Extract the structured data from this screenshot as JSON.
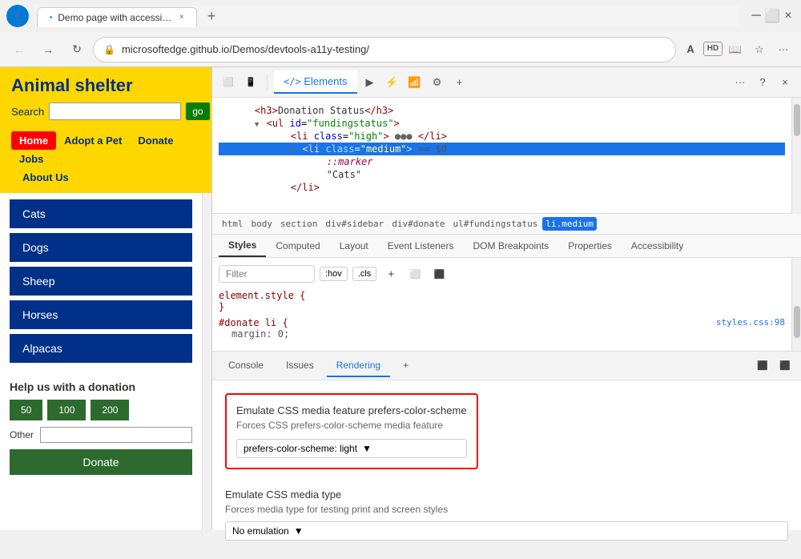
{
  "browser": {
    "title": "Demo page with accessibility iss…",
    "url": "microsoftedge.github.io/Demos/devtools-a11y-testing/",
    "tab_close": "×",
    "new_tab": "+"
  },
  "nav": {
    "back": "←",
    "forward": "→",
    "refresh": "↻",
    "search": "🔍"
  },
  "website": {
    "title": "Animal shelter",
    "search_label": "Search",
    "search_placeholder": "",
    "go_btn": "go",
    "menu": {
      "home": "Home",
      "adopt": "Adopt a Pet",
      "donate": "Donate",
      "jobs": "Jobs",
      "about": "About Us"
    },
    "animals": [
      "Cats",
      "Dogs",
      "Sheep",
      "Horses",
      "Alpacas"
    ],
    "donation_title": "Help us with a donation",
    "amounts": [
      "50",
      "100",
      "200"
    ],
    "other_label": "Other",
    "donate_btn": "Donate"
  },
  "devtools": {
    "tabs": [
      "←/>",
      "Elements",
      "⬜",
      "⚡",
      "📶",
      "⚙",
      "+"
    ],
    "elements_tab": "Elements",
    "more": "···",
    "question": "?",
    "close": "×",
    "dom": {
      "lines": [
        {
          "indent": 2,
          "content": "<h3>Donation Status</h3>"
        },
        {
          "indent": 2,
          "content": "▼ <ul id=\"fundingstatus\">"
        },
        {
          "indent": 3,
          "content": "<li class=\"high\"> ●●● </li>"
        },
        {
          "indent": 3,
          "content": "▼ <li class=\"medium\"> == $0"
        },
        {
          "indent": 4,
          "content": "::marker"
        },
        {
          "indent": 4,
          "content": "\"Cats\""
        },
        {
          "indent": 3,
          "content": "</li>"
        }
      ]
    },
    "breadcrumbs": [
      "html",
      "body",
      "section",
      "div#sidebar",
      "div#donate",
      "ul#fundingstatus",
      "li.medium"
    ],
    "styles_tabs": [
      "Styles",
      "Computed",
      "Layout",
      "Event Listeners",
      "DOM Breakpoints",
      "Properties",
      "Accessibility"
    ],
    "filter_placeholder": "Filter",
    "filter_toggle1": ":hov",
    "filter_toggle2": ".cls",
    "filter_icon1": "+",
    "filter_icon2": "⬜",
    "filter_icon3": "⬛",
    "style_rules": [
      {
        "selector": "element.style {",
        "close": "}",
        "properties": []
      },
      {
        "selector": "#donate li {",
        "close": "",
        "link": "styles.css:98",
        "properties": [
          "margin: 0;"
        ]
      }
    ],
    "bottom_tabs": [
      "Console",
      "Issues",
      "Rendering",
      "+"
    ],
    "rendering_active": true,
    "rendering": {
      "title1": "Emulate CSS media feature prefers-color-scheme",
      "sub1": "Forces CSS prefers-color-scheme media feature",
      "dropdown1": "prefers-color-scheme: light",
      "title2": "Emulate CSS media type",
      "sub2": "Forces media type for testing print and screen styles",
      "dropdown2": "No emulation"
    }
  }
}
